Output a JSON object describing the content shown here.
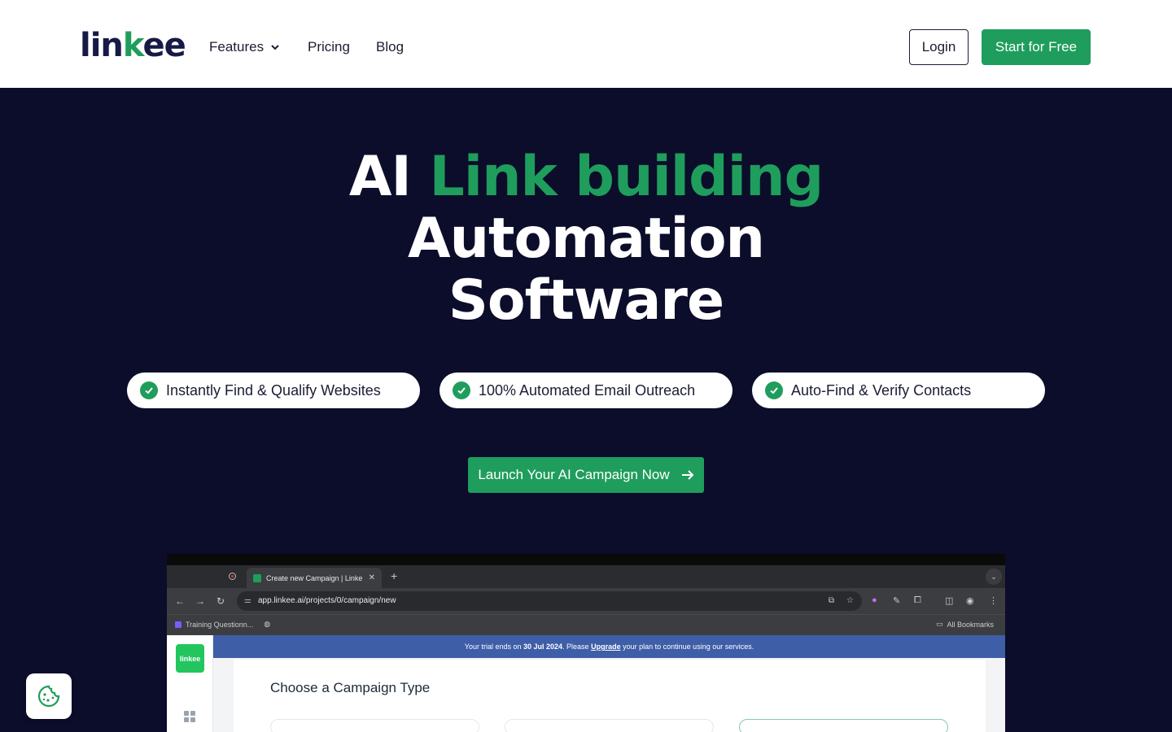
{
  "brand": {
    "logo_a": "lin",
    "logo_k": "k",
    "logo_b": "ee",
    "accent_color": "#1f9d5c",
    "navy": "#0b0d2b"
  },
  "nav": {
    "features_label": "Features",
    "pricing_label": "Pricing",
    "blog_label": "Blog",
    "login_label": "Login",
    "start_label": "Start for Free"
  },
  "hero": {
    "title_ai": "AI",
    "title_accent": "Link building",
    "title_line2": "Automation",
    "title_line3": "Software",
    "features": [
      "Instantly Find & Qualify Websites",
      "100% Automated Email Outreach",
      "Auto-Find & Verify Contacts"
    ],
    "cta_label": "Launch Your AI Campaign Now"
  },
  "mockup": {
    "tab_title": "Create new Campaign | Linke",
    "url": "app.linkee.ai/projects/0/campaign/new",
    "bookmark_1": "Training Questionn...",
    "bookmark_all": "All Bookmarks",
    "sidebar_logo": "linkee",
    "trial_pre": "Your trial ends on",
    "trial_date": "30 Jul 2024",
    "trial_mid": ". Please",
    "trial_link": "Upgrade",
    "trial_post": "your plan to continue using our services.",
    "card_title": "Choose a Campaign Type"
  },
  "icons": {
    "cookie": "cookie-icon",
    "check": "check-icon",
    "arrow": "arrow-right-icon",
    "chevron": "chevron-down-icon"
  }
}
